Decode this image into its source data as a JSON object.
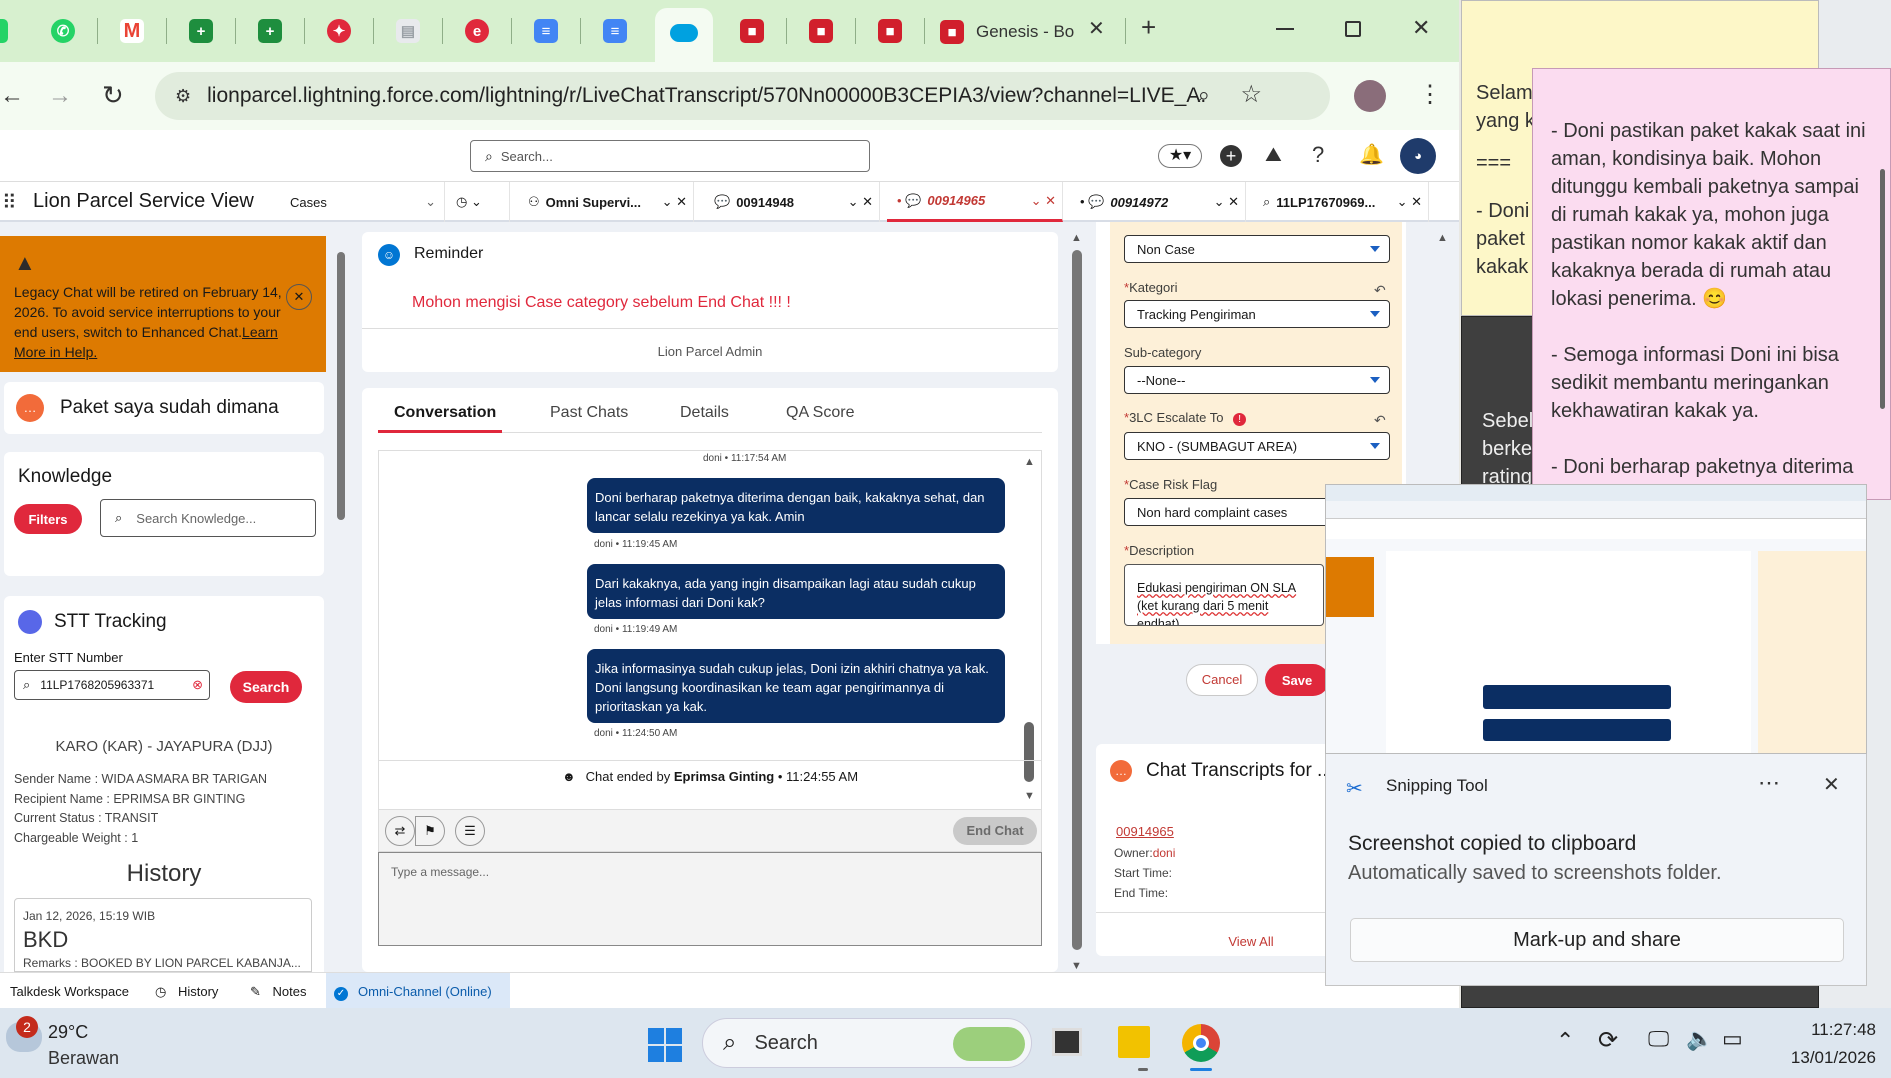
{
  "browser": {
    "tabs": [
      {
        "icon": "whatsapp-icon",
        "color": "#25d366"
      },
      {
        "icon": "gmail-icon",
        "color": "#ea4335"
      },
      {
        "icon": "sheets-icon",
        "color": "#1e8e3e"
      },
      {
        "icon": "sheets-icon",
        "color": "#1e8e3e"
      },
      {
        "icon": "lion-icon",
        "color": "#e0283c"
      },
      {
        "icon": "doc-icon",
        "color": "#9aa0a6"
      },
      {
        "icon": "e-icon",
        "color": "#e0283c"
      },
      {
        "icon": "docs-icon",
        "color": "#4285f4"
      },
      {
        "icon": "docs-icon",
        "color": "#4285f4"
      },
      {
        "icon": "salesforce-icon",
        "color": "#00a1e0"
      },
      {
        "icon": "box-icon",
        "color": "#d11f2c"
      },
      {
        "icon": "box-icon",
        "color": "#d11f2c"
      },
      {
        "icon": "box-icon",
        "color": "#d11f2c"
      }
    ],
    "last_tab_title": "Genesis - Bo",
    "url": "lionparcel.lightning.force.com/lightning/r/LiveChatTranscript/570Nn00000B3CEPIA3/view?channel=LIVE_A..."
  },
  "sf": {
    "search_placeholder": "Search...",
    "app_name": "Lion Parcel Service View",
    "nav_select": "Cases",
    "nav_tabs": [
      "Omni Supervi...",
      "00914948",
      "00914965",
      "00914972",
      "11LP17670969..."
    ]
  },
  "left": {
    "banner": "Legacy Chat will be retired on February 14, 2026. To avoid service interruptions to your end users, switch to Enhanced Chat.",
    "banner_link": "Learn More in Help.",
    "chat_title": "Paket saya sudah dimana",
    "knowledge_title": "Knowledge",
    "filters": "Filters",
    "knowledge_placeholder": "Search Knowledge...",
    "stt_title": "STT Tracking",
    "stt_label": "Enter STT Number",
    "stt_value": "11LP1768205963371",
    "search_btn": "Search",
    "route": "KARO (KAR) - JAYAPURA (DJJ)",
    "details": [
      "Sender Name : WIDA ASMARA BR TARIGAN",
      "Recipient Name : EPRIMSA BR GINTING",
      "Current Status : TRANSIT",
      "Chargeable Weight : 1"
    ],
    "history_title": "History",
    "history_date": "Jan 12, 2026, 15:19 WIB",
    "history_code": "BKD",
    "history_remarks": "Remarks : BOOKED BY LION PARCEL KABANJA..."
  },
  "center": {
    "reminder_title": "Reminder",
    "reminder_text": "Mohon mengisi Case category sebelum End Chat !!! !",
    "reminder_footer": "Lion Parcel Admin",
    "tabs": [
      "Conversation",
      "Past Chats",
      "Details",
      "QA Score"
    ],
    "top_meta": "doni • 11:17:54 AM",
    "messages": [
      {
        "text": "Doni berharap paketnya diterima dengan baik, kakaknya sehat, dan lancar selalu rezekinya ya kak. Amin",
        "meta": "doni • 11:19:45 AM"
      },
      {
        "text": "Dari kakaknya, ada yang ingin disampaikan lagi atau sudah cukup jelas informasi dari Doni kak?",
        "meta": "doni • 11:19:49 AM"
      },
      {
        "text": "Jika informasinya sudah cukup jelas, Doni izin akhiri chatnya ya kak. Doni langsung koordinasikan ke team agar pengirimannya di prioritaskan ya kak.",
        "meta": "doni • 11:24:50 AM"
      }
    ],
    "ended_prefix": "Chat ended by",
    "ended_name": "Eprimsa Ginting",
    "ended_time": "• 11:24:55 AM",
    "end_chat": "End Chat",
    "type_placeholder": "Type a message..."
  },
  "right": {
    "f1": "Non Case",
    "kategori_label": "Kategori",
    "kategori": "Tracking Pengiriman",
    "subcat_label": "Sub-category",
    "subcat": "--None--",
    "escalate_label": "3LC Escalate To",
    "escalate": "KNO - (SUMBAGUT AREA)",
    "risk_label": "Case Risk Flag",
    "risk": "Non hard complaint cases",
    "desc_label": "Description",
    "desc": "Edukasi pengiriman ON SLA (ket kurang dari 5 menit endhat)",
    "cancel": "Cancel",
    "save": "Save",
    "transcripts_title": "Chat Transcripts for ...",
    "transcript_id": "00914965",
    "owner_label": "Owner:",
    "owner": "doni",
    "start_label": "Start Time:",
    "end_label": "End Time:",
    "view_all": "View All"
  },
  "statusbar": [
    "Talkdesk Workspace",
    "History",
    "Notes",
    "Omni-Channel (Online)"
  ],
  "note_yellow": [
    "Selam",
    "yang k",
    "===",
    "- Doni",
    "paket",
    "kakak"
  ],
  "note_dark": [
    "Sebel",
    "berke",
    "rating"
  ],
  "note_pink": [
    "- Doni pastikan paket kakak saat ini aman, kondisinya baik. Mohon ditunggu kembali paketnya sampai di rumah kakak ya, mohon juga pastikan nomor kakak aktif dan kakaknya berada di rumah atau lokasi penerima. 😊",
    "- Semoga informasi Doni ini bisa sedikit membantu meringankan kekhawatiran kakak ya.",
    "- Doni berharap paketnya diterima"
  ],
  "snip": {
    "title": "Snipping Tool",
    "heading": "Screenshot copied to clipboard",
    "sub": "Automatically saved to screenshots folder.",
    "button": "Mark-up and share"
  },
  "taskbar": {
    "weather_badge": "2",
    "temp": "29°C",
    "cond": "Berawan",
    "search": "Search",
    "time": "11:27:48",
    "date": "13/01/2026"
  }
}
